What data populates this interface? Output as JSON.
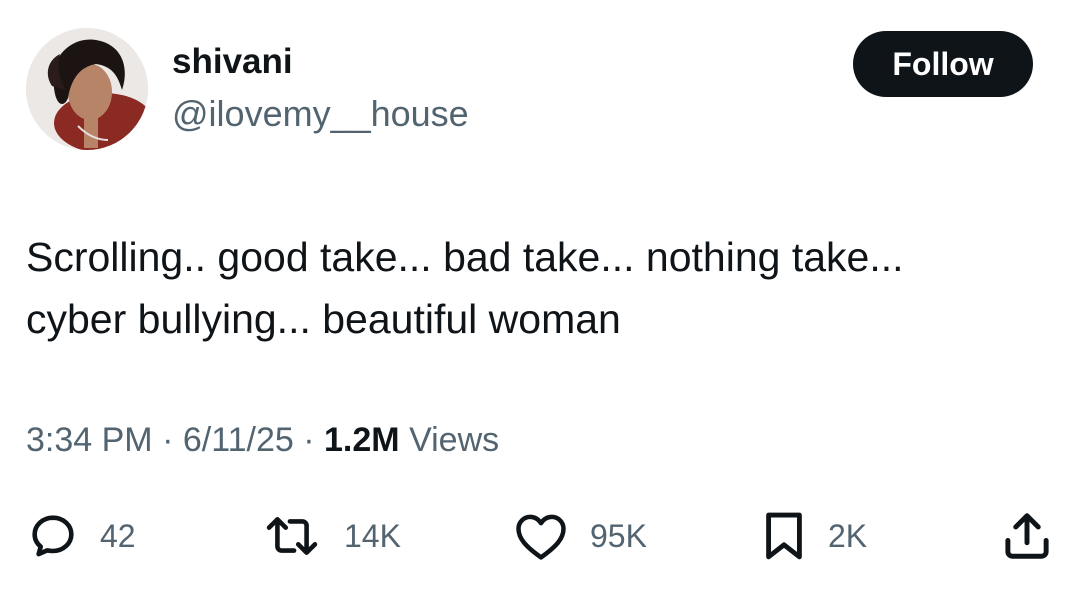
{
  "user": {
    "display_name": "shivani",
    "handle": "@ilovemy__house",
    "follow_label": "Follow"
  },
  "tweet": {
    "text_lines": [
      "Scrolling.. good take... bad take... nothing take...",
      "cyber bullying... beautiful woman"
    ],
    "time": "3:34 PM",
    "date": "6/11/25",
    "separator": "·",
    "views_count": "1.2M",
    "views_label": "Views"
  },
  "actions": {
    "replies": "42",
    "reposts": "14K",
    "likes": "95K",
    "bookmarks": "2K"
  },
  "icons": {
    "reply": "reply-icon",
    "repost": "repost-icon",
    "like": "heart-icon",
    "bookmark": "bookmark-icon",
    "share": "share-icon"
  },
  "colors": {
    "text_primary": "#0f1419",
    "text_secondary": "#536471",
    "button_bg": "#0f1419",
    "button_text": "#ffffff"
  }
}
